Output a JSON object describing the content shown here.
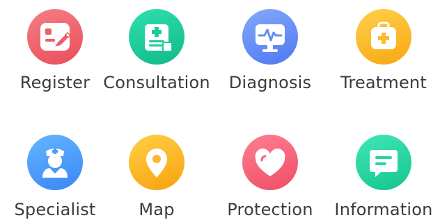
{
  "menu": {
    "items": [
      {
        "label": "Register",
        "icon": "register-form-icon",
        "color": "#ec5f6a"
      },
      {
        "label": "Consultation",
        "icon": "clipboard-plus-icon",
        "color": "#1ccc99"
      },
      {
        "label": "Diagnosis",
        "icon": "monitor-pulse-icon",
        "color": "#648df6"
      },
      {
        "label": "Treatment",
        "icon": "first-aid-kit-icon",
        "color": "#fbbb2c"
      },
      {
        "label": "Specialist",
        "icon": "doctor-icon",
        "color": "#4b9cf8"
      },
      {
        "label": "Map",
        "icon": "location-pin-icon",
        "color": "#fbb82a"
      },
      {
        "label": "Protection",
        "icon": "heart-icon",
        "color": "#f4647a"
      },
      {
        "label": "Information",
        "icon": "message-bubble-icon",
        "color": "#28d6a2"
      }
    ]
  }
}
